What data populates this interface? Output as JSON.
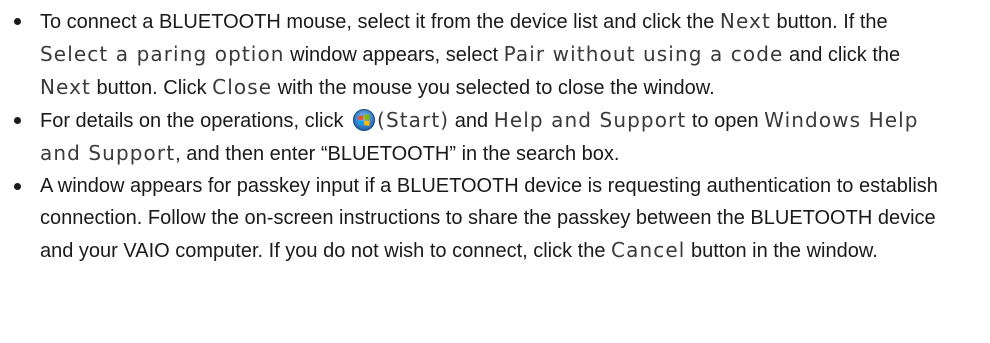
{
  "items": [
    {
      "segments": [
        {
          "t": "To connect a BLUETOOTH mouse, select it from the device list and click the "
        },
        {
          "t": "Next",
          "ui": true
        },
        {
          "t": " button. If the "
        },
        {
          "t": "Select a paring option",
          "ui": true
        },
        {
          "t": " window appears, select "
        },
        {
          "t": "Pair without using a code",
          "ui": true
        },
        {
          "t": " and click the "
        },
        {
          "t": "Next",
          "ui": true
        },
        {
          "t": " button. Click "
        },
        {
          "t": "Close",
          "ui": true
        },
        {
          "t": " with the mouse you selected to close the window."
        }
      ]
    },
    {
      "segments": [
        {
          "t": "For details on the operations, click "
        },
        {
          "icon": "windows-start-icon"
        },
        {
          "t": "(Start)",
          "ui": true
        },
        {
          "t": " and "
        },
        {
          "t": "Help and Support",
          "ui": true
        },
        {
          "t": " to open "
        },
        {
          "t": "Windows Help and Support",
          "ui": true
        },
        {
          "t": ", and then enter “BLUETOOTH” in the search box."
        }
      ]
    },
    {
      "segments": [
        {
          "t": "A window appears for passkey input if a BLUETOOTH device is requesting authentication to establish connection. Follow the on-screen instructions to share the passkey between the BLUETOOTH device and your VAIO computer. If you do not wish to connect, click the "
        },
        {
          "t": "Cancel",
          "ui": true
        },
        {
          "t": " button in the window."
        }
      ]
    }
  ]
}
